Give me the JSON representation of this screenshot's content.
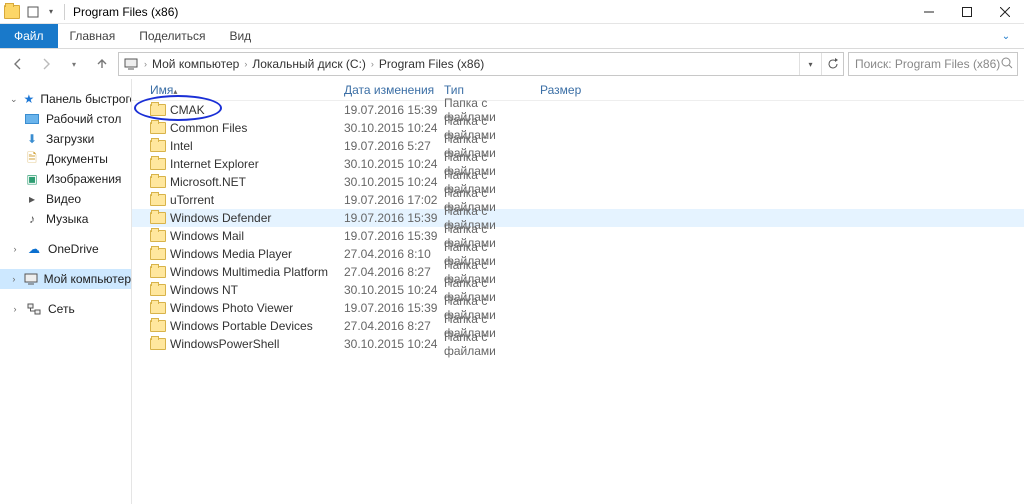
{
  "window_title": "Program Files (x86)",
  "ribbon": {
    "file": "Файл",
    "tabs": [
      "Главная",
      "Поделиться",
      "Вид"
    ]
  },
  "breadcrumbs": [
    "Мой компьютер",
    "Локальный диск (C:)",
    "Program Files (x86)"
  ],
  "search_placeholder": "Поиск: Program Files (x86)",
  "columns": {
    "name": "Имя",
    "date": "Дата изменения",
    "type": "Тип",
    "size": "Размер"
  },
  "sidebar": {
    "quick": {
      "label": "Панель быстрого до",
      "items": [
        {
          "label": "Рабочий стол",
          "icon": "desk"
        },
        {
          "label": "Загрузки",
          "icon": "dl"
        },
        {
          "label": "Документы",
          "icon": "doc"
        },
        {
          "label": "Изображения",
          "icon": "img"
        },
        {
          "label": "Видео",
          "icon": "vid"
        },
        {
          "label": "Музыка",
          "icon": "mus"
        }
      ]
    },
    "onedrive": "OneDrive",
    "thispc": "Мой компьютер",
    "network": "Сеть"
  },
  "files": [
    {
      "name": "CMAK",
      "date": "19.07.2016 15:39",
      "type": "Папка с файлами"
    },
    {
      "name": "Common Files",
      "date": "30.10.2015 10:24",
      "type": "Папка с файлами"
    },
    {
      "name": "Intel",
      "date": "19.07.2016 5:27",
      "type": "Папка с файлами"
    },
    {
      "name": "Internet Explorer",
      "date": "30.10.2015 10:24",
      "type": "Папка с файлами"
    },
    {
      "name": "Microsoft.NET",
      "date": "30.10.2015 10:24",
      "type": "Папка с файлами"
    },
    {
      "name": "uTorrent",
      "date": "19.07.2016 17:02",
      "type": "Папка с файлами"
    },
    {
      "name": "Windows Defender",
      "date": "19.07.2016 15:39",
      "type": "Папка с файлами",
      "hover": true
    },
    {
      "name": "Windows Mail",
      "date": "19.07.2016 15:39",
      "type": "Папка с файлами"
    },
    {
      "name": "Windows Media Player",
      "date": "27.04.2016 8:10",
      "type": "Папка с файлами"
    },
    {
      "name": "Windows Multimedia Platform",
      "date": "27.04.2016 8:27",
      "type": "Папка с файлами"
    },
    {
      "name": "Windows NT",
      "date": "30.10.2015 10:24",
      "type": "Папка с файлами"
    },
    {
      "name": "Windows Photo Viewer",
      "date": "19.07.2016 15:39",
      "type": "Папка с файлами"
    },
    {
      "name": "Windows Portable Devices",
      "date": "27.04.2016 8:27",
      "type": "Папка с файлами"
    },
    {
      "name": "WindowsPowerShell",
      "date": "30.10.2015 10:24",
      "type": "Папка с файлами"
    }
  ],
  "annotated_index": 0
}
